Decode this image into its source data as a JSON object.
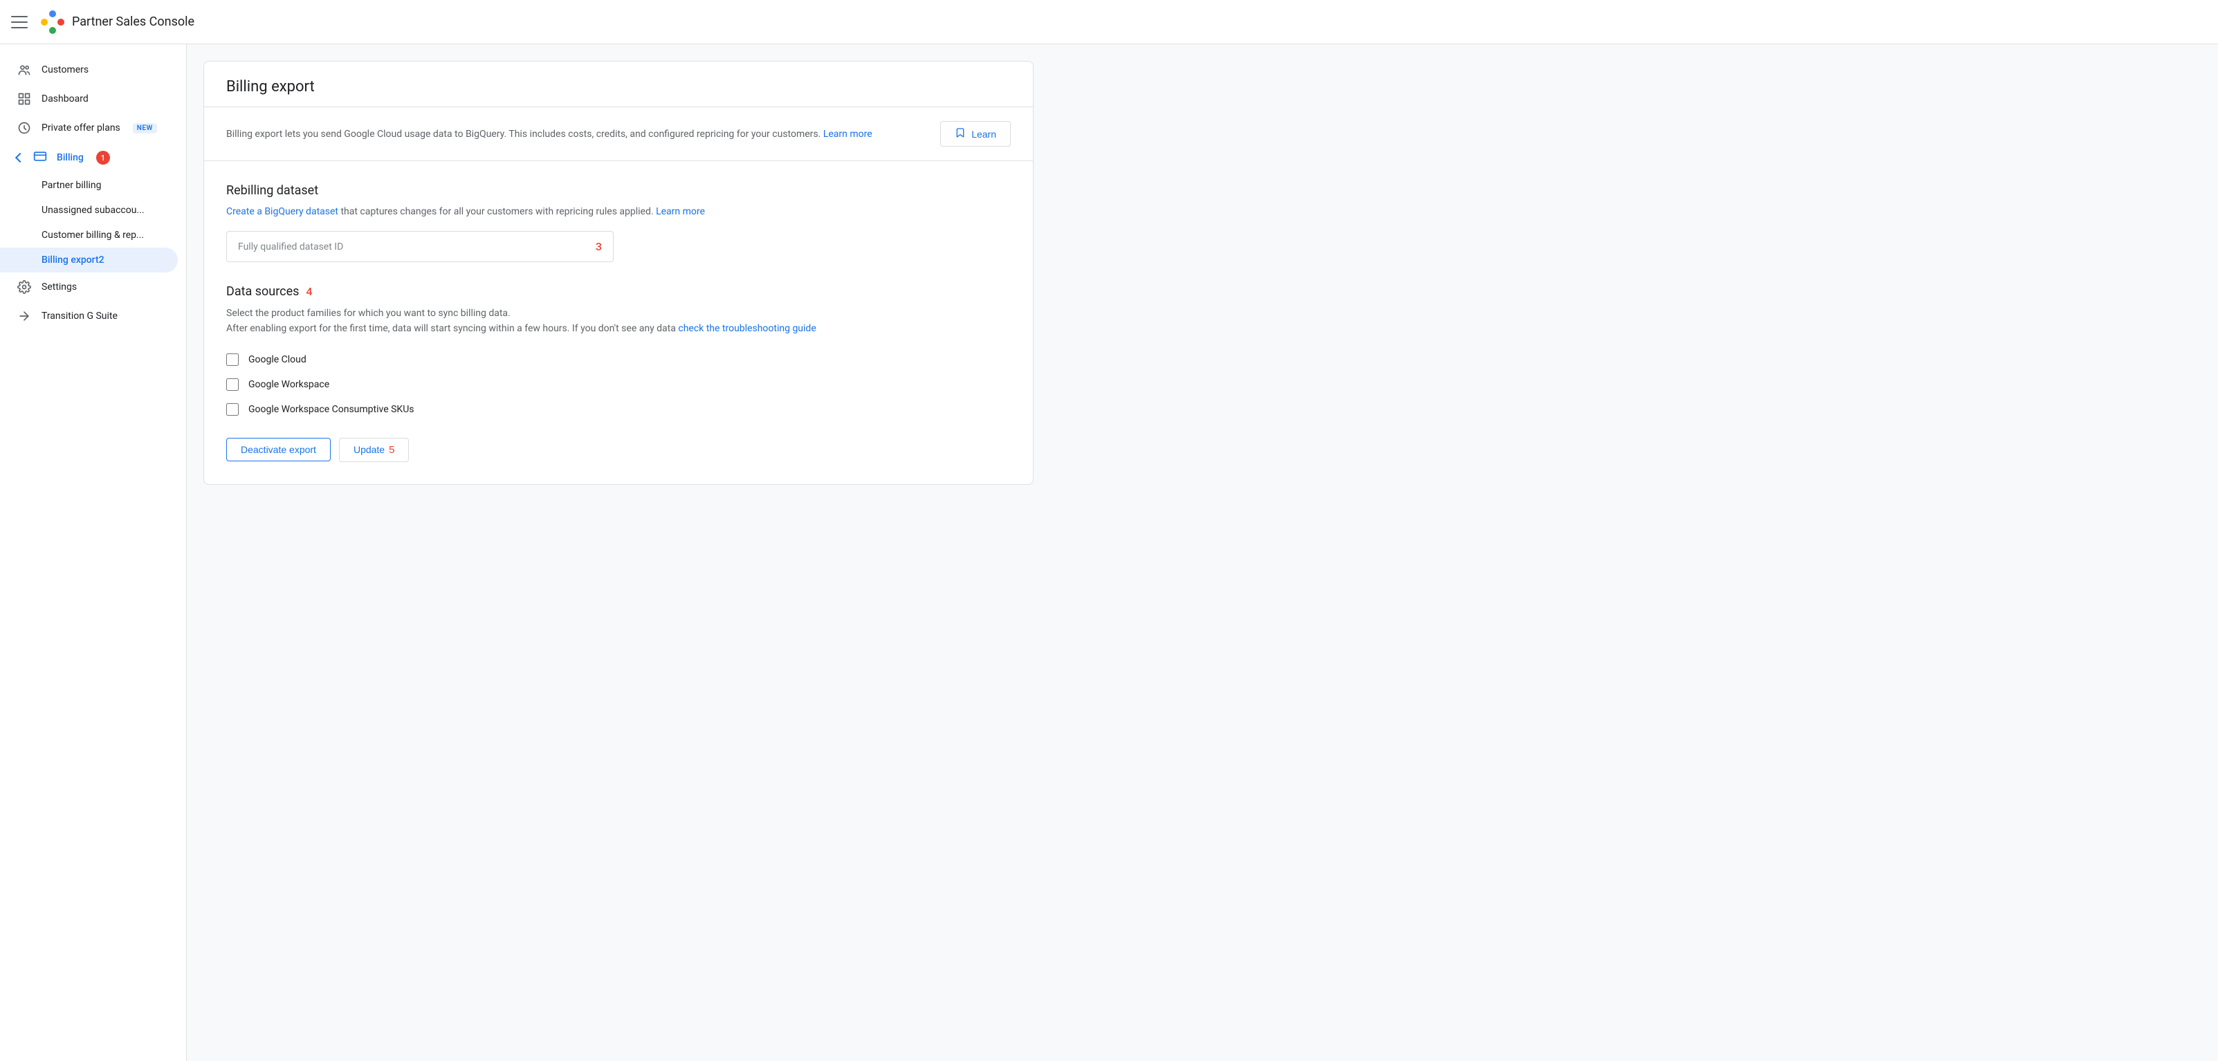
{
  "app": {
    "title": "Partner Sales Console"
  },
  "topbar": {
    "hamburger_label": "Menu"
  },
  "sidebar": {
    "customers_label": "Customers",
    "dashboard_label": "Dashboard",
    "private_offer_plans_label": "Private offer plans",
    "private_offer_plans_badge": "NEW",
    "billing_label": "Billing",
    "billing_badge": "1",
    "partner_billing_label": "Partner billing",
    "unassigned_label": "Unassigned subaccou...",
    "customer_billing_label": "Customer billing & rep...",
    "billing_export_label": "Billing export",
    "billing_export_badge": "2",
    "settings_label": "Settings",
    "transition_label": "Transition G Suite"
  },
  "page": {
    "title": "Billing export",
    "description_text": "Billing export lets you send Google Cloud usage data to BigQuery. This includes costs, credits, and configured repricing for your customers.",
    "description_learn_more": "Learn more",
    "learn_button_label": "Learn",
    "rebilling_title": "Rebilling dataset",
    "rebilling_link_text": "Create a BigQuery dataset",
    "rebilling_link_suffix": " that captures changes for all your customers with repricing rules applied.",
    "rebilling_learn_more": "Learn more",
    "dataset_placeholder": "Fully qualified dataset ID",
    "dataset_badge": "3",
    "data_sources_title": "Data sources",
    "data_sources_badge": "4",
    "data_sources_desc1": "Select the product families for which you want to sync billing data.",
    "data_sources_desc2": "After enabling export for the first time, data will start syncing within a few hours. If you don't see any data",
    "data_sources_link": "check the troubleshooting guide",
    "checkboxes": [
      {
        "id": "google-cloud",
        "label": "Google Cloud",
        "checked": false
      },
      {
        "id": "google-workspace",
        "label": "Google Workspace",
        "checked": false
      },
      {
        "id": "google-workspace-consumptive",
        "label": "Google Workspace Consumptive SKUs",
        "checked": false
      }
    ],
    "deactivate_label": "Deactivate export",
    "update_label": "Update",
    "update_badge": "5"
  }
}
